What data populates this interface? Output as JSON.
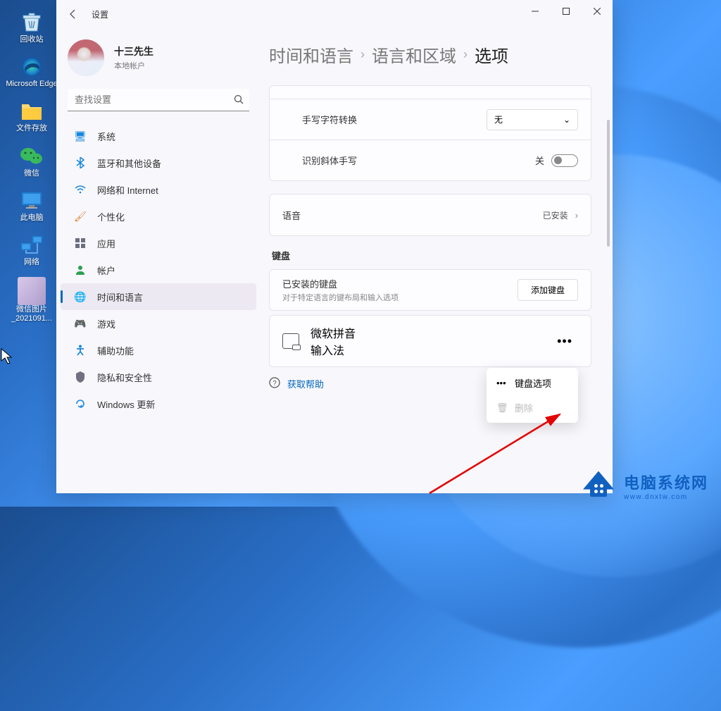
{
  "desktop": {
    "items": [
      {
        "label": "回收站"
      },
      {
        "label": "Microsoft Edge"
      },
      {
        "label": "文件存放"
      },
      {
        "label": "微信"
      },
      {
        "label": "此电脑"
      },
      {
        "label": "网络"
      },
      {
        "label": "微信图片_2021091..."
      }
    ]
  },
  "window": {
    "title": "设置",
    "profile": {
      "name": "十三先生",
      "sub": "本地帐户"
    },
    "search_placeholder": "查找设置",
    "nav": {
      "items": [
        {
          "label": "系统"
        },
        {
          "label": "蓝牙和其他设备"
        },
        {
          "label": "网络和 Internet"
        },
        {
          "label": "个性化"
        },
        {
          "label": "应用"
        },
        {
          "label": "帐户"
        },
        {
          "label": "时间和语言"
        },
        {
          "label": "游戏"
        },
        {
          "label": "辅助功能"
        },
        {
          "label": "隐私和安全性"
        },
        {
          "label": "Windows 更新"
        }
      ]
    },
    "breadcrumb": {
      "a": "时间和语言",
      "b": "语言和区域",
      "c": "选项"
    },
    "handwriting": {
      "row1_label": "手写字符转换",
      "row1_value": "无",
      "row2_label": "识别斜体手写",
      "row2_toggle": "关"
    },
    "speech": {
      "label": "语音",
      "value": "已安装"
    },
    "keyboards_header": "键盘",
    "installed_kb": {
      "title": "已安装的键盘",
      "sub": "对于特定语言的键布局和输入选项",
      "add": "添加键盘"
    },
    "ime": {
      "title": "微软拼音",
      "sub": "输入法"
    },
    "context": {
      "kb_options": "键盘选项",
      "delete": "删除"
    },
    "help": "获取帮助"
  },
  "watermark": {
    "t1": "电脑系统网",
    "t2": "www.dnxtw.com"
  }
}
